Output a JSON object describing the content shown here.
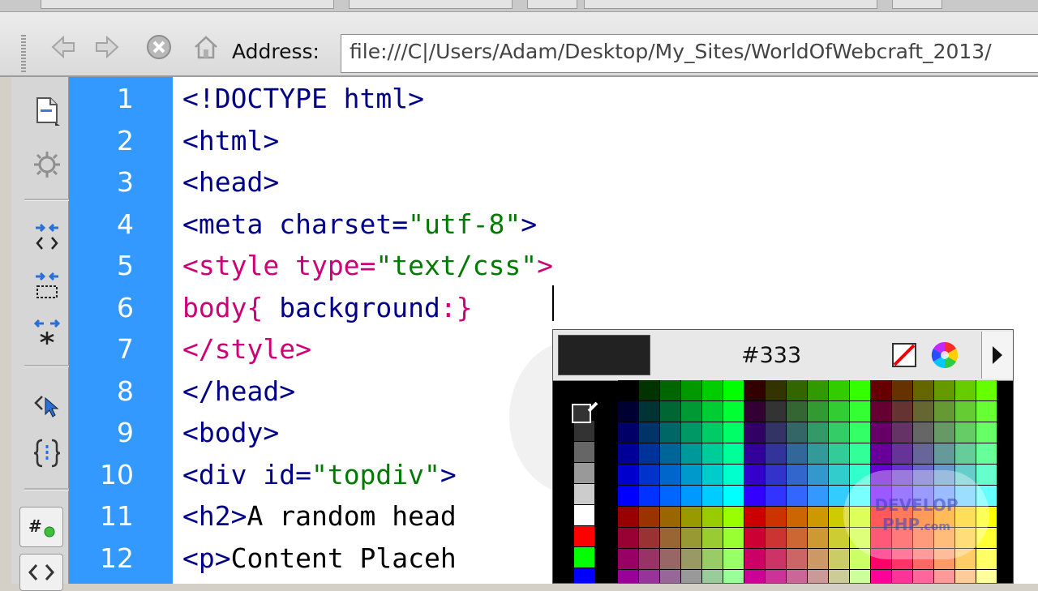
{
  "address": {
    "label": "Address:",
    "value": "file:///C|/Users/Adam/Desktop/My_Sites/WorldOfWebcraft_2013/"
  },
  "nav_icons": [
    "back-arrow-icon",
    "forward-arrow-icon",
    "stop-icon",
    "home-icon"
  ],
  "tools": [
    "document-icon",
    "settings-icon",
    "collapse-tag-icon",
    "collapse-selection-icon",
    "expand-all-icon",
    "select-parent-icon",
    "balance-braces-icon",
    "line-numbers-icon",
    "code-icon"
  ],
  "editor": {
    "line_numbers": [
      "1",
      "2",
      "3",
      "4",
      "5",
      "6",
      "7",
      "8",
      "9",
      "10",
      "11",
      "12"
    ],
    "lines": [
      [
        {
          "t": "<!DOCTYPE html>",
          "c": "tag"
        }
      ],
      [
        {
          "t": "<html>",
          "c": "tag"
        }
      ],
      [
        {
          "t": "<head>",
          "c": "tag"
        }
      ],
      [
        {
          "t": "<meta ",
          "c": "tag"
        },
        {
          "t": "charset=",
          "c": "attr"
        },
        {
          "t": "\"utf-8\"",
          "c": "val"
        },
        {
          "t": ">",
          "c": "tag"
        }
      ],
      [
        {
          "t": "<style ",
          "c": "style"
        },
        {
          "t": "type=",
          "c": "style"
        },
        {
          "t": "\"text/css\"",
          "c": "val"
        },
        {
          "t": ">",
          "c": "style"
        }
      ],
      [
        {
          "t": "body{ ",
          "c": "style"
        },
        {
          "t": "background",
          "c": "css"
        },
        {
          "t": ":",
          "c": "style"
        },
        {
          "t": "}",
          "c": "style"
        }
      ],
      [
        {
          "t": "</style>",
          "c": "style"
        }
      ],
      [
        {
          "t": "</head>",
          "c": "tag"
        }
      ],
      [
        {
          "t": "<body>",
          "c": "tag"
        }
      ],
      [
        {
          "t": "<div ",
          "c": "tag"
        },
        {
          "t": "id=",
          "c": "attr"
        },
        {
          "t": "\"topdiv\"",
          "c": "val"
        },
        {
          "t": ">",
          "c": "tag"
        }
      ],
      [
        {
          "t": "<h2>",
          "c": "tag"
        },
        {
          "t": "A random head",
          "c": "txt"
        }
      ],
      [
        {
          "t": "<p>",
          "c": "tag"
        },
        {
          "t": "Content Placeh",
          "c": "txt"
        }
      ]
    ]
  },
  "color_picker": {
    "hex": "#333",
    "selected_color": "#222222",
    "icons": [
      "no-color-icon",
      "color-wheel-icon",
      "menu-arrow-icon"
    ],
    "gray_column": [
      "#333333",
      "#666666",
      "#999999",
      "#cccccc",
      "#ffffff",
      "#ff0000",
      "#00ff00",
      "#0000ff",
      "#ffff00"
    ]
  },
  "watermark": {
    "line1": "DEVELOP",
    "line2": "PHP",
    "line3": ".com"
  }
}
